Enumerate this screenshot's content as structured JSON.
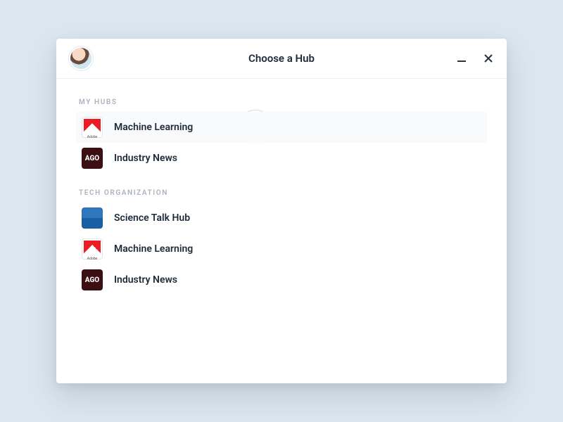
{
  "window": {
    "title": "Choose a Hub"
  },
  "sections": [
    {
      "label": "My Hubs",
      "items": [
        {
          "brand": "adobe",
          "label": "Machine Learning",
          "selected": true
        },
        {
          "brand": "ago",
          "label": "Industry News"
        }
      ]
    },
    {
      "label": "Tech Organization",
      "items": [
        {
          "brand": "amex",
          "label": "Science Talk Hub"
        },
        {
          "brand": "adobe",
          "label": "Machine Learning"
        },
        {
          "brand": "ago",
          "label": "Industry News"
        }
      ]
    }
  ]
}
